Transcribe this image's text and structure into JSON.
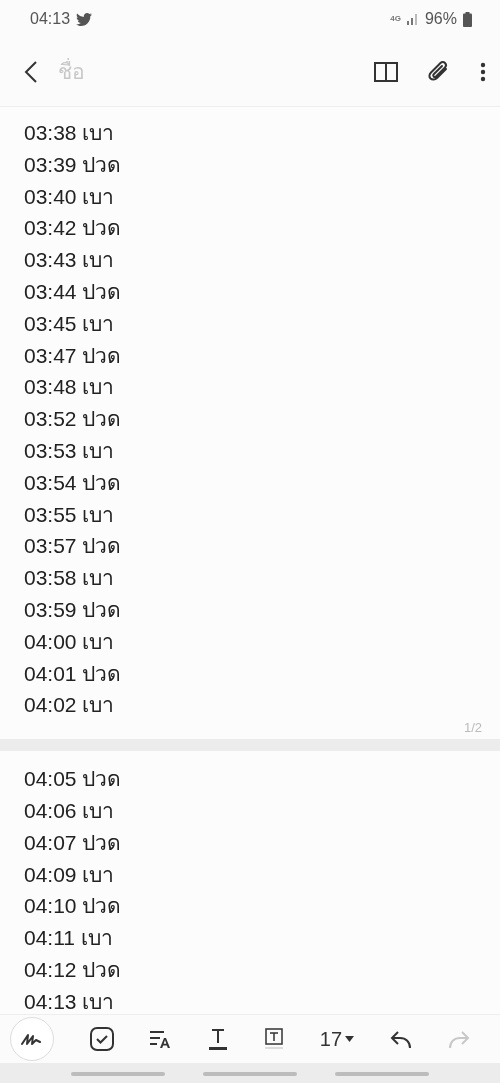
{
  "status_bar": {
    "time": "04:13",
    "network": "4G",
    "battery": "96%"
  },
  "title_field": {
    "placeholder": "ชื่อ"
  },
  "pages": [
    {
      "lines": [
        "03:38 เบา",
        "03:39 ปวด",
        "03:40 เบา",
        "03:42 ปวด",
        "03:43 เบา",
        "03:44 ปวด",
        "03:45 เบา",
        "03:47 ปวด",
        "03:48 เบา",
        "03:52 ปวด",
        "03:53 เบา",
        "03:54 ปวด",
        "03:55 เบา",
        "03:57 ปวด",
        "03:58 เบา",
        "03:59 ปวด",
        "04:00 เบา",
        "04:01 ปวด",
        "04:02 เบา"
      ],
      "page_number": "1/2"
    },
    {
      "lines": [
        "04:05 ปวด",
        "04:06 เบา",
        "04:07 ปวด",
        "04:09 เบา",
        "04:10 ปวด",
        "04:11 เบา",
        "04:12 ปวด",
        "04:13 เบา"
      ]
    }
  ],
  "toolbar": {
    "font_size": "17",
    "redo_disabled": true
  }
}
